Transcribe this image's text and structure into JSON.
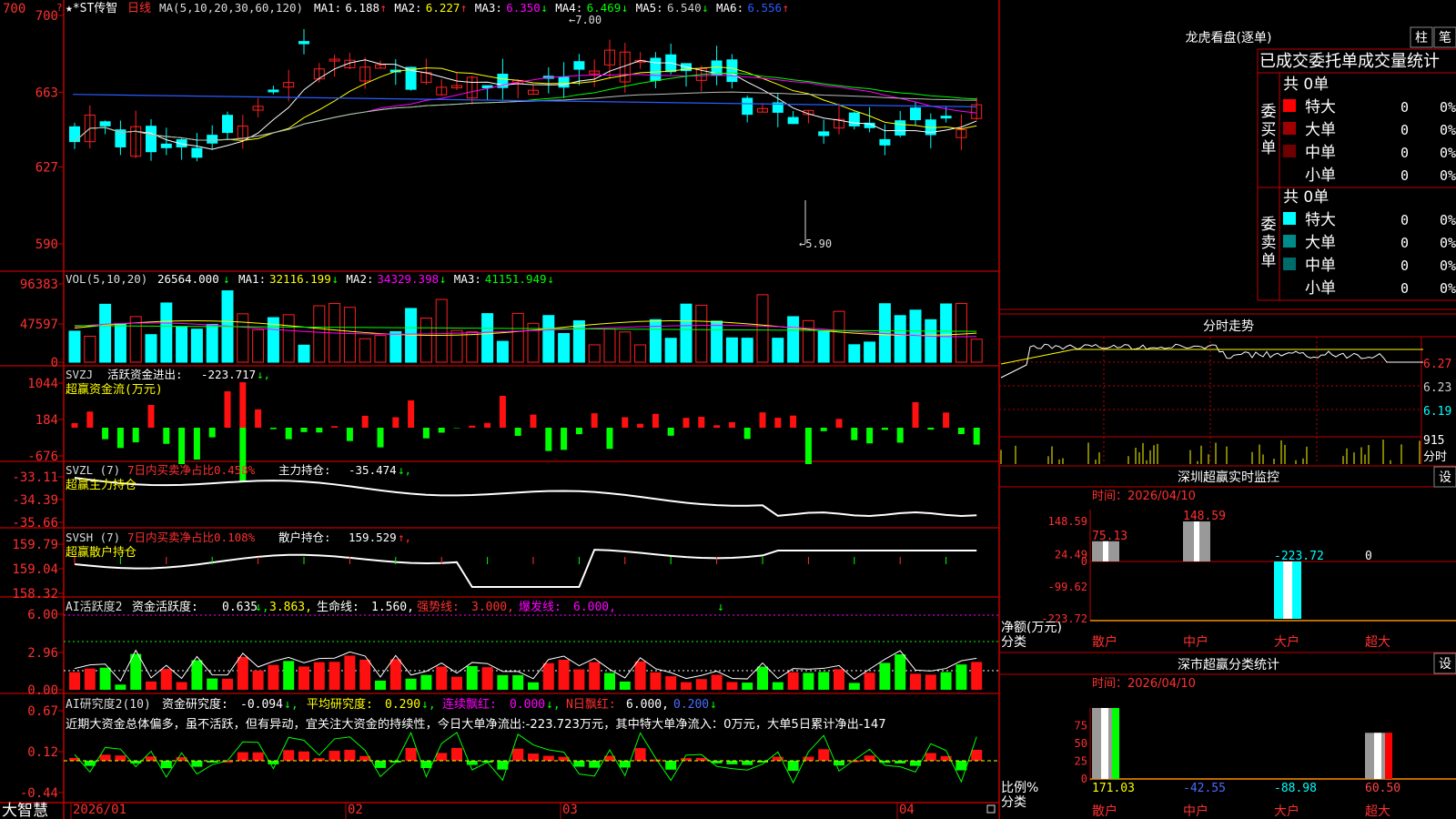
{
  "title_stock": "★*ST传智",
  "title_period": "日线",
  "main": {
    "ma_label": "MA(5,10,20,30,60,120)",
    "ma": [
      {
        "name": "MA1:",
        "value": "6.188",
        "arrow": "↑",
        "color": "#ffffff"
      },
      {
        "name": "MA2:",
        "value": "6.227",
        "arrow": "↑",
        "color": "#ffff00"
      },
      {
        "name": "MA3:",
        "value": "6.350",
        "arrow": "↓",
        "color": "#ff00ff"
      },
      {
        "name": "MA4:",
        "value": "6.469",
        "arrow": "↓",
        "color": "#00ff00"
      },
      {
        "name": "MA5:",
        "value": "6.540",
        "arrow": "↓",
        "color": "#cccccc"
      },
      {
        "name": "MA6:",
        "value": "6.556",
        "arrow": "↑",
        "color": "#2a5cff"
      }
    ],
    "y_ticks": [
      "700",
      "663",
      "627",
      "590"
    ],
    "high_label": "7.00",
    "low_label": "5.90"
  },
  "vol": {
    "label": "VOL(5,10,20)",
    "value": "26564.000",
    "ma": [
      {
        "name": "MA1:",
        "value": "32116.199",
        "arrow": "↓",
        "color": "#ffff00"
      },
      {
        "name": "MA2:",
        "value": "34329.398",
        "arrow": "↓",
        "color": "#ff00ff"
      },
      {
        "name": "MA3:",
        "value": "41151.949",
        "arrow": "↓",
        "color": "#00ff00"
      }
    ],
    "y_ticks": [
      "96383",
      "47597",
      "0"
    ]
  },
  "svzj": {
    "label": "SVZJ",
    "text1": "活跃资金进出:",
    "value": "-223.717",
    "arrow": "↓",
    "subtitle": "超赢资金流(万元)",
    "y_ticks": [
      "1044",
      "184",
      "-676"
    ]
  },
  "svzl": {
    "label": "SVZL (7)",
    "text1": "7日内买卖净占比0.458%",
    "text2": "主力持仓:",
    "value": "-35.474",
    "arrow": "↓",
    "subtitle": "超赢主力持仓",
    "y_ticks": [
      "-33.11",
      "-34.39",
      "-35.66"
    ]
  },
  "svsh": {
    "label": "SVSH (7)",
    "text1": "7日内买卖净占比0.108%",
    "text2": "散户持仓:",
    "value": "159.529",
    "arrow": "↑",
    "subtitle": "超赢散户持仓",
    "y_ticks": [
      "159.79",
      "159.04",
      "158.32"
    ]
  },
  "ai_active": {
    "label": "AI活跃度2",
    "t1": "资金活跃度:",
    "v1": "0.635",
    "a1": "↓",
    "v2": "3.863",
    "t3": "生命线:",
    "v3": "1.560",
    "t4": "强势线:",
    "v4": "3.000",
    "t5": "爆发线:",
    "v5": "6.000",
    "y_ticks": [
      "6.00",
      "2.96",
      "0.00"
    ]
  },
  "ai_research": {
    "label": "AI研究度2(10)",
    "t1": "资金研究度:",
    "v1": "-0.094",
    "t2": "平均研究度:",
    "v2": "0.290",
    "t3": "连续飘红:",
    "v3": "0.000",
    "t4": "N日飘红:",
    "v4": "6.000",
    "v5": "0.200",
    "comment": "近期大资金总体偏多，虽不活跃，但有异动，宜关注大资金的持续性，今日大单净流出:-223.723万元，其中特大单净流入：0万元，大单5日累计净出-147",
    "y_ticks": [
      "0.67",
      "0.12",
      "-0.44"
    ]
  },
  "x_axis": {
    "brand": "大智慧",
    "labels": [
      "2026/01",
      "02",
      "03",
      "04"
    ]
  },
  "right": {
    "lhb_title": "龙虎看盘(逐单)",
    "btn_bar": "柱",
    "btn_pen": "笔",
    "tabs": "已成交委托单成交量统计",
    "buy_side": "委买单",
    "sell_side": "委卖单",
    "buy_total": "共 0单",
    "sell_total": "共 0单",
    "buy_rows": [
      {
        "name": "特大",
        "count": "0",
        "pct": "0%",
        "color": "#ff0000"
      },
      {
        "name": "大单",
        "count": "0",
        "pct": "0%",
        "color": "#a00000"
      },
      {
        "name": "中单",
        "count": "0",
        "pct": "0%",
        "color": "#700000"
      },
      {
        "name": "小单",
        "count": "0",
        "pct": "0%",
        "color": "#000000"
      }
    ],
    "sell_rows": [
      {
        "name": "特大",
        "count": "0",
        "pct": "0%",
        "color": "#00ffff"
      },
      {
        "name": "大单",
        "count": "0",
        "pct": "0%",
        "color": "#008b8b"
      },
      {
        "name": "中单",
        "count": "0",
        "pct": "0%",
        "color": "#006b6b"
      },
      {
        "name": "小单",
        "count": "0",
        "pct": "0%",
        "color": "#000000"
      }
    ],
    "intraday_title": "分时走势",
    "intraday_ticks": [
      "6.27",
      "6.23",
      "6.19"
    ],
    "intraday_vol": "915",
    "intraday_unit": "分时",
    "monitor_title": "深圳超赢实时监控",
    "monitor_btn": "设",
    "monitor_time": "时间：2026/04/10",
    "monitor_ticks": [
      "148.59",
      "24.49",
      "0",
      "-99.62",
      "-223.72"
    ],
    "monitor_bar_values": [
      {
        "cat": "散户",
        "value": 75.13,
        "label": "75.13"
      },
      {
        "cat": "中户",
        "value": 148.59,
        "label": "148.59"
      },
      {
        "cat": "大户",
        "value": -223.72,
        "label": "-223.72"
      },
      {
        "cat": "超大",
        "value": 0,
        "label": "0"
      }
    ],
    "monitor_unit1": "净额(万元)",
    "monitor_unit2": "分类",
    "stat_title": "深市超赢分类统计",
    "stat_btn": "设",
    "stat_time": "时间：2026/04/10",
    "stat_ticks": [
      "75",
      "50",
      "25",
      "0"
    ],
    "stat_values": [
      {
        "cat": "散户",
        "value": "171.03",
        "pct": 100,
        "color": "#ffff00"
      },
      {
        "cat": "中户",
        "value": "-42.55",
        "pct": 0,
        "color": "#4a6cff"
      },
      {
        "cat": "大户",
        "value": "-88.98",
        "pct": 0,
        "color": "#00ffff"
      },
      {
        "cat": "超大",
        "value": "60.50",
        "pct": 65,
        "color": "#ff4444"
      }
    ],
    "stat_unit1": "比例%",
    "stat_unit2": "分类"
  }
}
